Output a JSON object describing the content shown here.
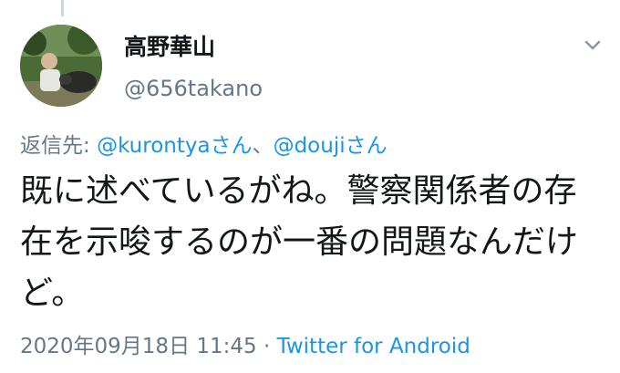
{
  "author": {
    "display_name": "高野華山",
    "handle": "@656takano"
  },
  "reply": {
    "prefix": "返信先: ",
    "mention_1": "@kurontyaさん",
    "separator": "、",
    "mention_2": "@doujiさん"
  },
  "tweet": {
    "text": "既に述べているがね。警察関係者の存在を示唆するのが一番の問題なんだけど。"
  },
  "meta": {
    "timestamp": "2020年09月18日 11:45",
    "dot": " · ",
    "source": "Twitter for Android"
  },
  "icons": {
    "menu": "chevron-down-icon",
    "avatar": "profile-photo"
  },
  "colors": {
    "link": "#1b95e0",
    "secondary": "#657786",
    "text": "#14171a"
  }
}
